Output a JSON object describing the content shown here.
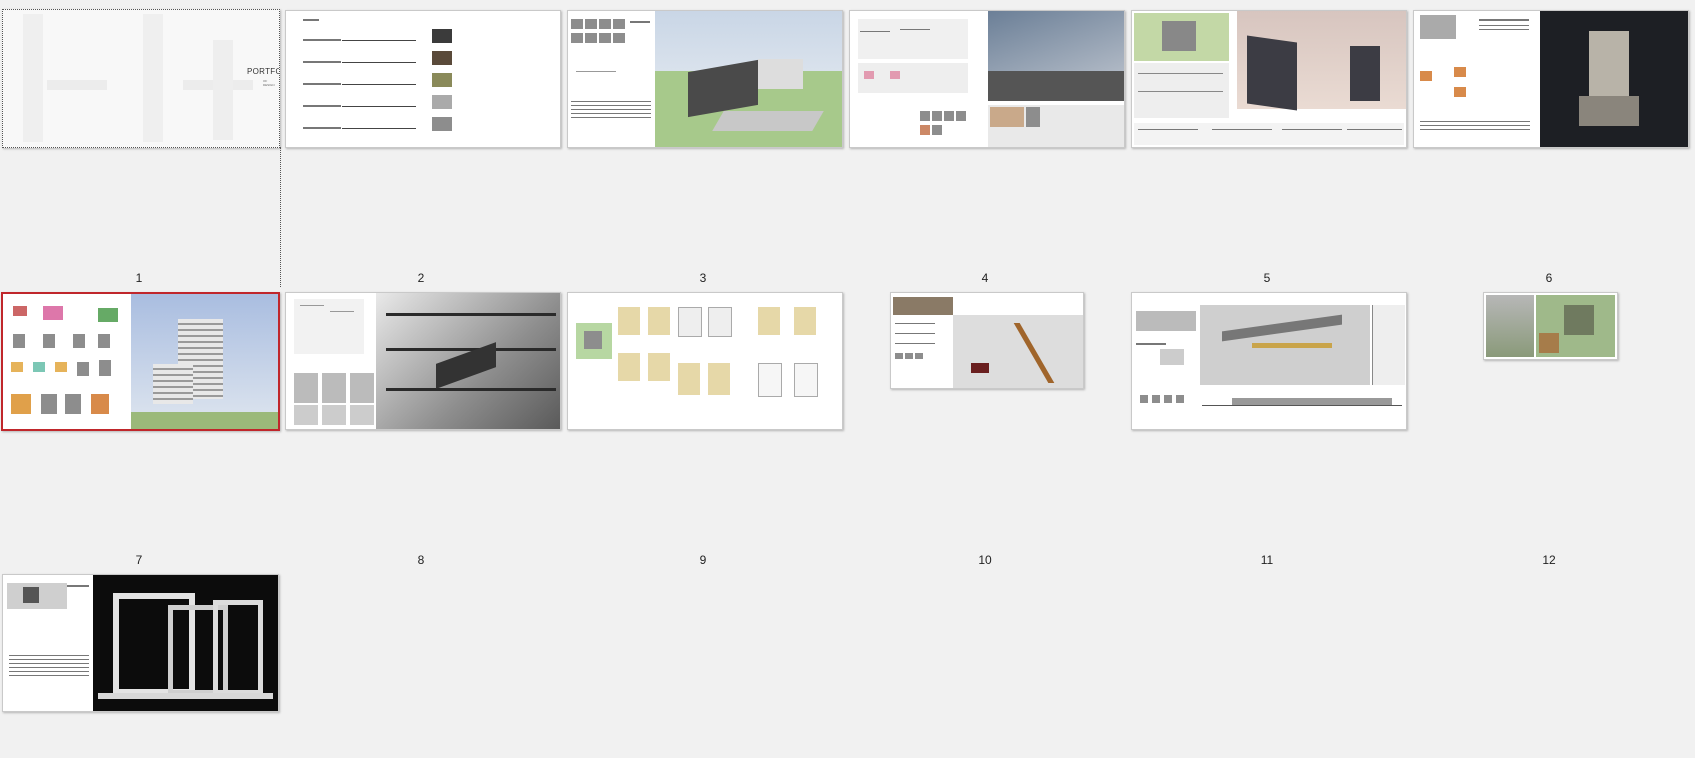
{
  "sorter": {
    "cover": {
      "title": "PORTFOLIO",
      "subtitle": "OF DESIGN"
    },
    "slides": [
      {
        "number": "1",
        "selected": false
      },
      {
        "number": "2",
        "selected": false
      },
      {
        "number": "3",
        "selected": false
      },
      {
        "number": "4",
        "selected": false
      },
      {
        "number": "5",
        "selected": false
      },
      {
        "number": "6",
        "selected": false
      },
      {
        "number": "7",
        "selected": true
      },
      {
        "number": "8",
        "selected": false
      },
      {
        "number": "9",
        "selected": false
      },
      {
        "number": "10",
        "selected": false
      },
      {
        "number": "11",
        "selected": false
      },
      {
        "number": "12",
        "selected": false
      }
    ],
    "colors": {
      "background": "#f1f1f1",
      "selection": "#c0262b"
    }
  }
}
